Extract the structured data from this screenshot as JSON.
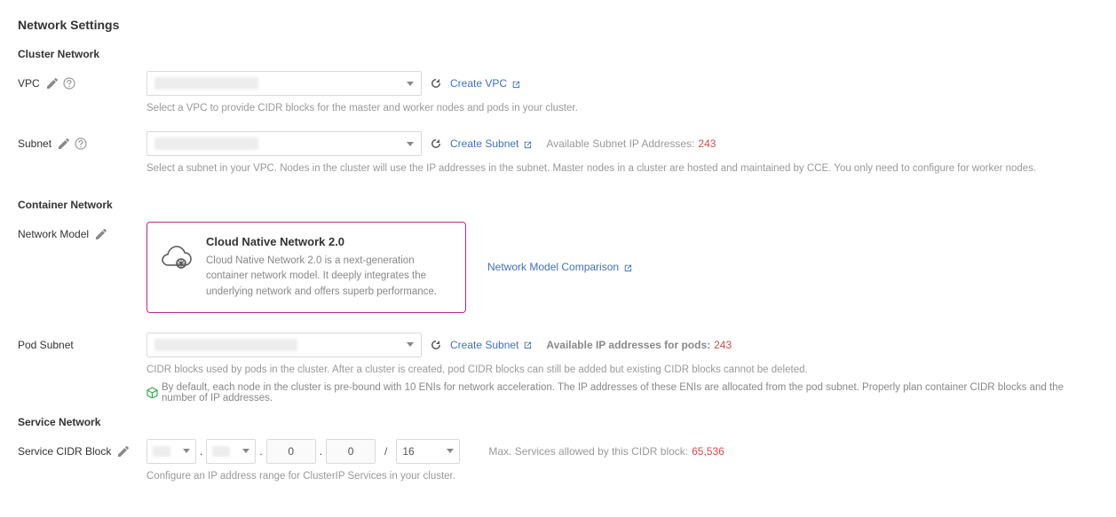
{
  "page_title": "Network Settings",
  "cluster_network": {
    "title": "Cluster Network",
    "vpc": {
      "label": "VPC",
      "create_link": "Create VPC",
      "help": "Select a VPC to provide CIDR blocks for the master and worker nodes and pods in your cluster."
    },
    "subnet": {
      "label": "Subnet",
      "create_link": "Create Subnet",
      "available_label": "Available Subnet IP Addresses:",
      "available_count": "243",
      "help": "Select a subnet in your VPC. Nodes in the cluster will use the IP addresses in the subnet. Master nodes in a cluster are hosted and maintained by CCE. You only need to configure for worker nodes."
    }
  },
  "container_network": {
    "title": "Container Network",
    "model": {
      "label": "Network Model",
      "card_title": "Cloud Native Network 2.0",
      "card_desc": "Cloud Native Network 2.0 is a next-generation container network model. It deeply integrates the underlying network and offers superb performance.",
      "compare_link": "Network Model Comparison"
    },
    "pod_subnet": {
      "label": "Pod Subnet",
      "create_link": "Create Subnet",
      "available_label": "Available IP addresses for pods:",
      "available_count": "243",
      "help": "CIDR blocks used by pods in the cluster. After a cluster is created, pod CIDR blocks can still be added but existing CIDR blocks cannot be deleted.",
      "tip": "By default, each node in the cluster is pre-bound with 10 ENIs for network acceleration. The IP addresses of these ENIs are allocated from the pod subnet. Properly plan container CIDR blocks and the number of IP addresses."
    }
  },
  "service_network": {
    "title": "Service Network",
    "cidr": {
      "label": "Service CIDR Block",
      "octet3": "0",
      "octet4": "0",
      "prefix": "16",
      "max_label": "Max. Services allowed by this CIDR block:",
      "max_count": "65,536",
      "help": "Configure an IP address range for ClusterIP Services in your cluster."
    }
  }
}
